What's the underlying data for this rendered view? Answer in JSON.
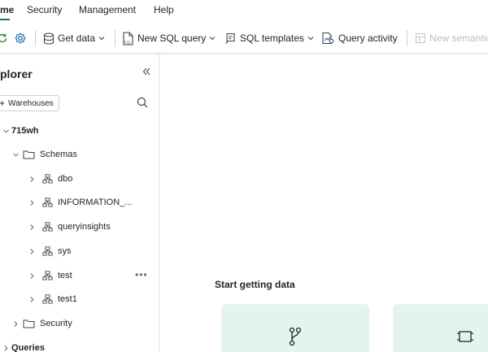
{
  "menu": {
    "items": [
      {
        "label": "me",
        "active": true
      },
      {
        "label": "Security",
        "active": false
      },
      {
        "label": "Management",
        "active": false
      },
      {
        "label": "Help",
        "active": false
      }
    ]
  },
  "toolbar": {
    "get_data": "Get data",
    "new_sql_query": "New SQL query",
    "sql_templates": "SQL templates",
    "query_activity": "Query activity",
    "new_semantic": "New semantic",
    "sql_badge": "SQL"
  },
  "explorer": {
    "title": "plorer",
    "add_warehouses": "Warehouses",
    "tree": {
      "warehouse": "715wh",
      "schemas": "Schemas",
      "schema_items": [
        "dbo",
        "INFORMATION_...",
        "queryinsights",
        "sys",
        "test",
        "test1"
      ],
      "security": "Security",
      "queries": "Queries"
    }
  },
  "main": {
    "start_heading": "Start getting data"
  },
  "colors": {
    "accent": "#117865",
    "card_bg": "#e3f4ef",
    "icon_blue": "#2b6cb0"
  }
}
